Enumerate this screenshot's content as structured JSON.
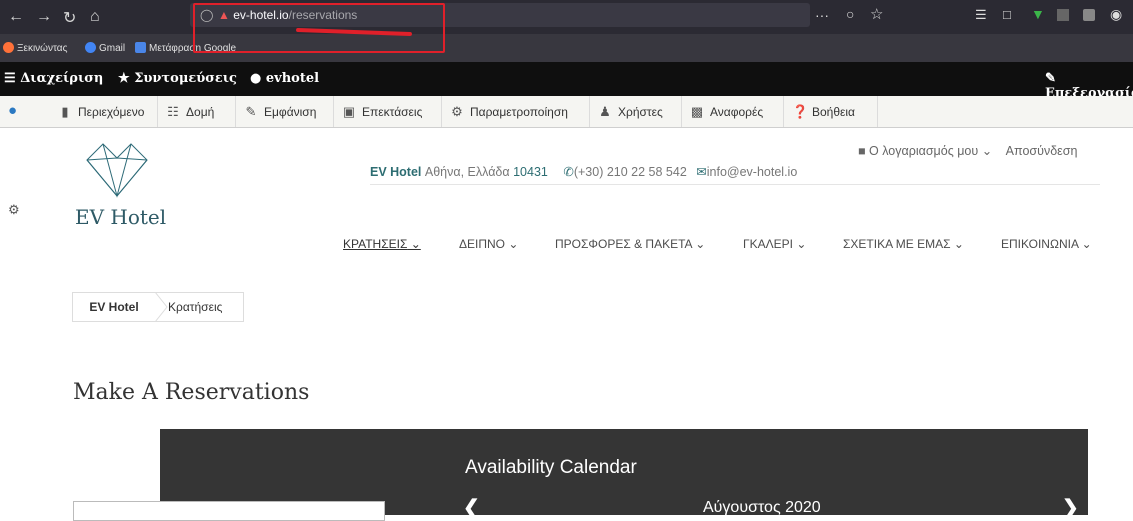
{
  "browser": {
    "url_domain": "ev-hotel.io",
    "url_path": "/reservations",
    "menu_glyph": "···"
  },
  "bookmarks": [
    "Ξεκινώντας",
    "Gmail",
    "Μετάφραση Google"
  ],
  "admin_toolbar": {
    "manage": "Διαχείριση",
    "shortcuts": "Συντομεύσεις",
    "user": "evhotel",
    "edit": "Επεξεργασία"
  },
  "admin_tray": [
    "Περιεχόμενο",
    "Δομή",
    "Εμφάνιση",
    "Επεκτάσεις",
    "Παραμετροποίηση",
    "Χρήστες",
    "Αναφορές",
    "Βοήθεια"
  ],
  "site": {
    "logo_text": "EV Hotel",
    "contact_name": "EV Hotel",
    "contact_address": "Αθήνα, Ελλάδα",
    "contact_zip": "10431",
    "phone": "(+30) 210 22 58 542",
    "email": "info@ev-hotel.io",
    "account": "Ο λογαριασμός μου",
    "logout": "Αποσύνδεση"
  },
  "main_nav": [
    "ΚΡΑΤΗΣΕΙΣ",
    "ΔΕΙΠΝΟ",
    "ΠΡΟΣΦΟΡΕΣ & ΠΑΚΕΤΑ",
    "ΓΚΑΛΕΡΙ",
    "ΣΧΕΤΙΚΑ ΜΕ ΕΜΑΣ",
    "ΕΠΙΚΟΙΝΩΝΙΑ"
  ],
  "breadcrumb": {
    "home": "EV Hotel",
    "current": "Κρατήσεις"
  },
  "page": {
    "title": "Make A Reservations"
  },
  "calendar": {
    "title": "Availability Calendar",
    "month": "Αύγουστος 2020"
  },
  "colors": {
    "accent": "#2d6d72",
    "admin_bar": "#0f0f0f",
    "panel": "#353535",
    "highlight": "#e0202a"
  }
}
